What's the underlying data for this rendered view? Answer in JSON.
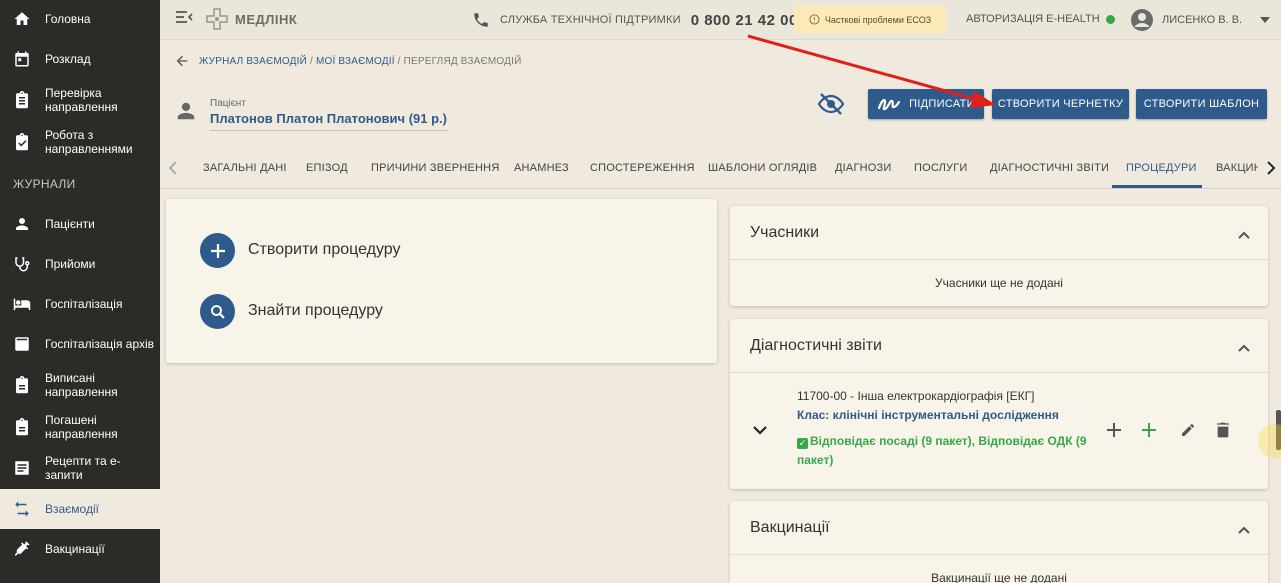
{
  "colors": {
    "accent": "#2f5b8c",
    "sidebar_bg": "#2c2b28",
    "success": "#37a84a",
    "warning_bg": "#fbe9b8",
    "annotation_arrow": "#e0201b"
  },
  "sidebar": {
    "items": [
      {
        "label": "Головна",
        "icon": "home-icon"
      },
      {
        "label": "Розклад",
        "icon": "calendar-icon"
      },
      {
        "label": "Перевірка направлення",
        "icon": "clipboard-icon"
      },
      {
        "label": "Робота з направленнями",
        "icon": "clipboard-check-icon"
      },
      {
        "label": "Пацієнти",
        "icon": "person-icon"
      },
      {
        "label": "Прийоми",
        "icon": "stethoscope-icon"
      },
      {
        "label": "Госпіталізація",
        "icon": "bed-icon"
      },
      {
        "label": "Госпіталізація архів",
        "icon": "archive-icon"
      },
      {
        "label": "Виписані направлення",
        "icon": "clipboard-icon"
      },
      {
        "label": "Погашені направлення",
        "icon": "clipboard-icon"
      },
      {
        "label": "Рецепти та е-запити",
        "icon": "document-list-icon"
      },
      {
        "label": "Взаємодії",
        "icon": "swap-arrows-icon",
        "active": true
      },
      {
        "label": "Вакцинації",
        "icon": "syringe-icon"
      }
    ],
    "section_label": "ЖУРНАЛИ"
  },
  "header": {
    "logo": "МЕДЛІНК",
    "support_label": "СЛУЖБА ТЕХНІЧНОЇ ПІДТРИМКИ",
    "support_phone": "0 800 21 42 00",
    "warning": "Часткові проблеми ЕСОЗ",
    "ehealth": "АВТОРИЗАЦІЯ E-HEALTH",
    "user": "ЛИСЕНКО В. В."
  },
  "breadcrumb": {
    "journal": "ЖУРНАЛ ВЗАЄМОДІЙ",
    "mine": "МОЇ ВЗАЄМОДІЇ",
    "current": "ПЕРЕГЛЯД ВЗАЄМОДІЙ",
    "sep": "/"
  },
  "patient": {
    "label": "Пацієнт",
    "name": "Платонов Платон Платонович (91 р.)"
  },
  "actions": {
    "sign": "ПІДПИСАТИ",
    "draft": "СТВОРИТИ ЧЕРНЕТКУ",
    "template": "СТВОРИТИ ШАБЛОН"
  },
  "tabs": [
    "ЗАГАЛЬНІ ДАНІ",
    "ЕПІЗОД",
    "ПРИЧИНИ ЗВЕРНЕННЯ",
    "АНАМНЕЗ",
    "СПОСТЕРЕЖЕННЯ",
    "ШАБЛОНИ ОГЛЯДІВ",
    "ДІАГНОЗИ",
    "ПОСЛУГИ",
    "ДІАГНОСТИЧНІ ЗВІТИ",
    "ПРОЦЕДУРИ",
    "ВАКЦИН"
  ],
  "active_tab": "ПРОЦЕДУРИ",
  "procedure_card": {
    "create": "Створити процедуру",
    "find": "Знайти процедуру"
  },
  "participants": {
    "title": "Учасники",
    "empty": "Учасники ще не додані"
  },
  "diagnostic_reports": {
    "title": "Діагностичні звіти",
    "code": "11700-00 - Інша електрокардіографія [ЕКГ]",
    "class": "Клас: клінічні інструментальні дослідження",
    "status": "Відповідає посаді (9 пакет), Відповідає ОДК (9 пакет)"
  },
  "vaccinations": {
    "title": "Вакцинації",
    "empty": "Вакцинації ще не додані"
  }
}
